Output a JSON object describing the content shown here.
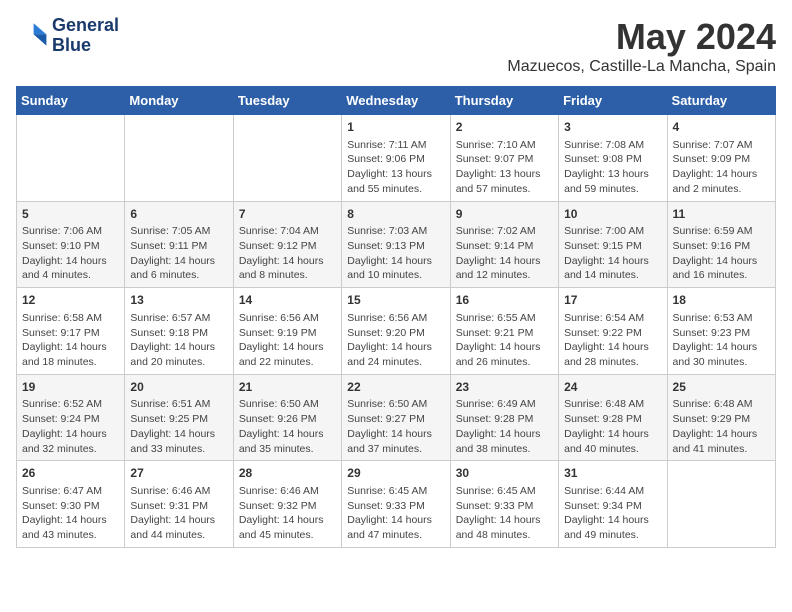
{
  "header": {
    "logo_line1": "General",
    "logo_line2": "Blue",
    "month_year": "May 2024",
    "location": "Mazuecos, Castille-La Mancha, Spain"
  },
  "calendar": {
    "days_of_week": [
      "Sunday",
      "Monday",
      "Tuesday",
      "Wednesday",
      "Thursday",
      "Friday",
      "Saturday"
    ],
    "weeks": [
      [
        {
          "day": "",
          "content": ""
        },
        {
          "day": "",
          "content": ""
        },
        {
          "day": "",
          "content": ""
        },
        {
          "day": "1",
          "content": "Sunrise: 7:11 AM\nSunset: 9:06 PM\nDaylight: 13 hours\nand 55 minutes."
        },
        {
          "day": "2",
          "content": "Sunrise: 7:10 AM\nSunset: 9:07 PM\nDaylight: 13 hours\nand 57 minutes."
        },
        {
          "day": "3",
          "content": "Sunrise: 7:08 AM\nSunset: 9:08 PM\nDaylight: 13 hours\nand 59 minutes."
        },
        {
          "day": "4",
          "content": "Sunrise: 7:07 AM\nSunset: 9:09 PM\nDaylight: 14 hours\nand 2 minutes."
        }
      ],
      [
        {
          "day": "5",
          "content": "Sunrise: 7:06 AM\nSunset: 9:10 PM\nDaylight: 14 hours\nand 4 minutes."
        },
        {
          "day": "6",
          "content": "Sunrise: 7:05 AM\nSunset: 9:11 PM\nDaylight: 14 hours\nand 6 minutes."
        },
        {
          "day": "7",
          "content": "Sunrise: 7:04 AM\nSunset: 9:12 PM\nDaylight: 14 hours\nand 8 minutes."
        },
        {
          "day": "8",
          "content": "Sunrise: 7:03 AM\nSunset: 9:13 PM\nDaylight: 14 hours\nand 10 minutes."
        },
        {
          "day": "9",
          "content": "Sunrise: 7:02 AM\nSunset: 9:14 PM\nDaylight: 14 hours\nand 12 minutes."
        },
        {
          "day": "10",
          "content": "Sunrise: 7:00 AM\nSunset: 9:15 PM\nDaylight: 14 hours\nand 14 minutes."
        },
        {
          "day": "11",
          "content": "Sunrise: 6:59 AM\nSunset: 9:16 PM\nDaylight: 14 hours\nand 16 minutes."
        }
      ],
      [
        {
          "day": "12",
          "content": "Sunrise: 6:58 AM\nSunset: 9:17 PM\nDaylight: 14 hours\nand 18 minutes."
        },
        {
          "day": "13",
          "content": "Sunrise: 6:57 AM\nSunset: 9:18 PM\nDaylight: 14 hours\nand 20 minutes."
        },
        {
          "day": "14",
          "content": "Sunrise: 6:56 AM\nSunset: 9:19 PM\nDaylight: 14 hours\nand 22 minutes."
        },
        {
          "day": "15",
          "content": "Sunrise: 6:56 AM\nSunset: 9:20 PM\nDaylight: 14 hours\nand 24 minutes."
        },
        {
          "day": "16",
          "content": "Sunrise: 6:55 AM\nSunset: 9:21 PM\nDaylight: 14 hours\nand 26 minutes."
        },
        {
          "day": "17",
          "content": "Sunrise: 6:54 AM\nSunset: 9:22 PM\nDaylight: 14 hours\nand 28 minutes."
        },
        {
          "day": "18",
          "content": "Sunrise: 6:53 AM\nSunset: 9:23 PM\nDaylight: 14 hours\nand 30 minutes."
        }
      ],
      [
        {
          "day": "19",
          "content": "Sunrise: 6:52 AM\nSunset: 9:24 PM\nDaylight: 14 hours\nand 32 minutes."
        },
        {
          "day": "20",
          "content": "Sunrise: 6:51 AM\nSunset: 9:25 PM\nDaylight: 14 hours\nand 33 minutes."
        },
        {
          "day": "21",
          "content": "Sunrise: 6:50 AM\nSunset: 9:26 PM\nDaylight: 14 hours\nand 35 minutes."
        },
        {
          "day": "22",
          "content": "Sunrise: 6:50 AM\nSunset: 9:27 PM\nDaylight: 14 hours\nand 37 minutes."
        },
        {
          "day": "23",
          "content": "Sunrise: 6:49 AM\nSunset: 9:28 PM\nDaylight: 14 hours\nand 38 minutes."
        },
        {
          "day": "24",
          "content": "Sunrise: 6:48 AM\nSunset: 9:28 PM\nDaylight: 14 hours\nand 40 minutes."
        },
        {
          "day": "25",
          "content": "Sunrise: 6:48 AM\nSunset: 9:29 PM\nDaylight: 14 hours\nand 41 minutes."
        }
      ],
      [
        {
          "day": "26",
          "content": "Sunrise: 6:47 AM\nSunset: 9:30 PM\nDaylight: 14 hours\nand 43 minutes."
        },
        {
          "day": "27",
          "content": "Sunrise: 6:46 AM\nSunset: 9:31 PM\nDaylight: 14 hours\nand 44 minutes."
        },
        {
          "day": "28",
          "content": "Sunrise: 6:46 AM\nSunset: 9:32 PM\nDaylight: 14 hours\nand 45 minutes."
        },
        {
          "day": "29",
          "content": "Sunrise: 6:45 AM\nSunset: 9:33 PM\nDaylight: 14 hours\nand 47 minutes."
        },
        {
          "day": "30",
          "content": "Sunrise: 6:45 AM\nSunset: 9:33 PM\nDaylight: 14 hours\nand 48 minutes."
        },
        {
          "day": "31",
          "content": "Sunrise: 6:44 AM\nSunset: 9:34 PM\nDaylight: 14 hours\nand 49 minutes."
        },
        {
          "day": "",
          "content": ""
        }
      ]
    ]
  }
}
